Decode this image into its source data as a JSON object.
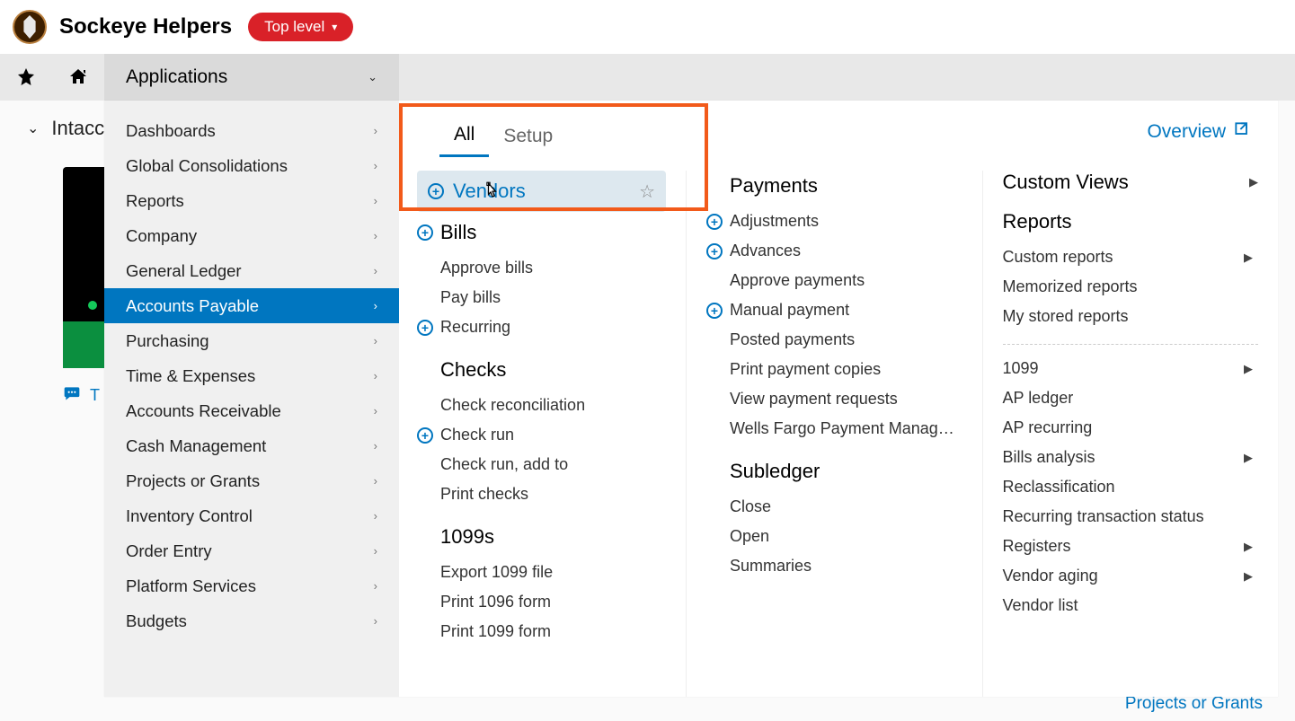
{
  "header": {
    "company": "Sockeye Helpers",
    "top_level_label": "Top level"
  },
  "nav": {
    "applications_label": "Applications"
  },
  "background": {
    "title": "Intacct",
    "chat_prefix": "T",
    "footer_link": "Projects or Grants"
  },
  "sidemenu": [
    "Dashboards",
    "Global Consolidations",
    "Reports",
    "Company",
    "General Ledger",
    "Accounts Payable",
    "Purchasing",
    "Time & Expenses",
    "Accounts Receivable",
    "Cash Management",
    "Projects or Grants",
    "Inventory Control",
    "Order Entry",
    "Platform Services",
    "Budgets"
  ],
  "tabs": {
    "all": "All",
    "setup": "Setup",
    "overview": "Overview"
  },
  "col1": {
    "vendors": "Vendors",
    "bills_head": "Bills",
    "approve_bills": "Approve bills",
    "pay_bills": "Pay bills",
    "recurring": "Recurring",
    "checks_head": "Checks",
    "check_recon": "Check reconciliation",
    "check_run": "Check run",
    "check_run_add": "Check run, add to",
    "print_checks": "Print checks",
    "x1099_head": "1099s",
    "export_1099": "Export 1099 file",
    "print_1096": "Print 1096 form",
    "print_1099": "Print 1099 form"
  },
  "col2": {
    "payments_head": "Payments",
    "adjustments": "Adjustments",
    "advances": "Advances",
    "approve_payments": "Approve payments",
    "manual_payment": "Manual payment",
    "posted_payments": "Posted payments",
    "print_copies": "Print payment copies",
    "view_requests": "View payment requests",
    "wells": "Wells Fargo Payment Manag…",
    "subledger_head": "Subledger",
    "close": "Close",
    "open": "Open",
    "summaries": "Summaries"
  },
  "col3": {
    "custom_views": "Custom Views",
    "reports_head": "Reports",
    "custom_reports": "Custom reports",
    "memorized": "Memorized reports",
    "stored": "My stored reports",
    "x1099": "1099",
    "ap_ledger": "AP ledger",
    "ap_recurring": "AP recurring",
    "bills_analysis": "Bills analysis",
    "reclass": "Reclassification",
    "recurring_status": "Recurring transaction status",
    "registers": "Registers",
    "vendor_aging": "Vendor aging",
    "vendor_list": "Vendor list"
  }
}
